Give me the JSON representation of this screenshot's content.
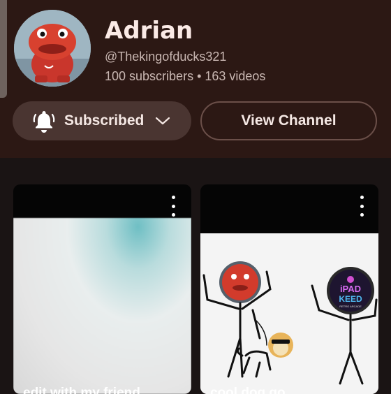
{
  "channel": {
    "name": "Adrian",
    "handle": "@Thekingofducks321",
    "stats": "100 subscribers • 163 videos"
  },
  "buttons": {
    "subscribed_label": "Subscribed",
    "view_channel_label": "View Channel"
  },
  "icons": {
    "subscribe": "bell-icon",
    "dropdown": "chevron-down-icon",
    "more": "more-vertical-icon"
  },
  "videos": [
    {
      "title": "edit with my friend"
    },
    {
      "title": "cool dog go"
    }
  ],
  "thumbnail_badge": {
    "line1": "iPAD",
    "line2": "KEED",
    "line3": "RETRO ARCADE"
  },
  "colors": {
    "header_bg": "#2c1814",
    "page_bg": "#1a1414",
    "button_fill": "#4a3531",
    "text_primary": "#fbeae6",
    "text_secondary": "#c9b7b2"
  }
}
